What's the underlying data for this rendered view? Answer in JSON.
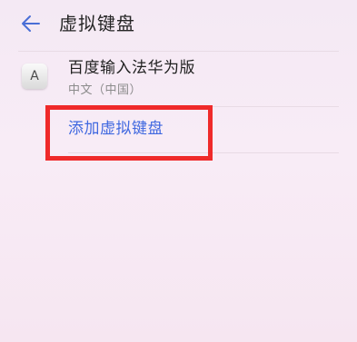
{
  "header": {
    "title": "虚拟键盘",
    "back_icon": "arrow-left-icon"
  },
  "keyboards": [
    {
      "icon_letter": "A",
      "name": "百度输入法华为版",
      "language": "中文（中国）"
    }
  ],
  "actions": {
    "add_keyboard_label": "添加虚拟键盘"
  },
  "colors": {
    "accent": "#4169e0",
    "highlight_box": "#ef2a2a",
    "background": "#f8ecf5"
  }
}
